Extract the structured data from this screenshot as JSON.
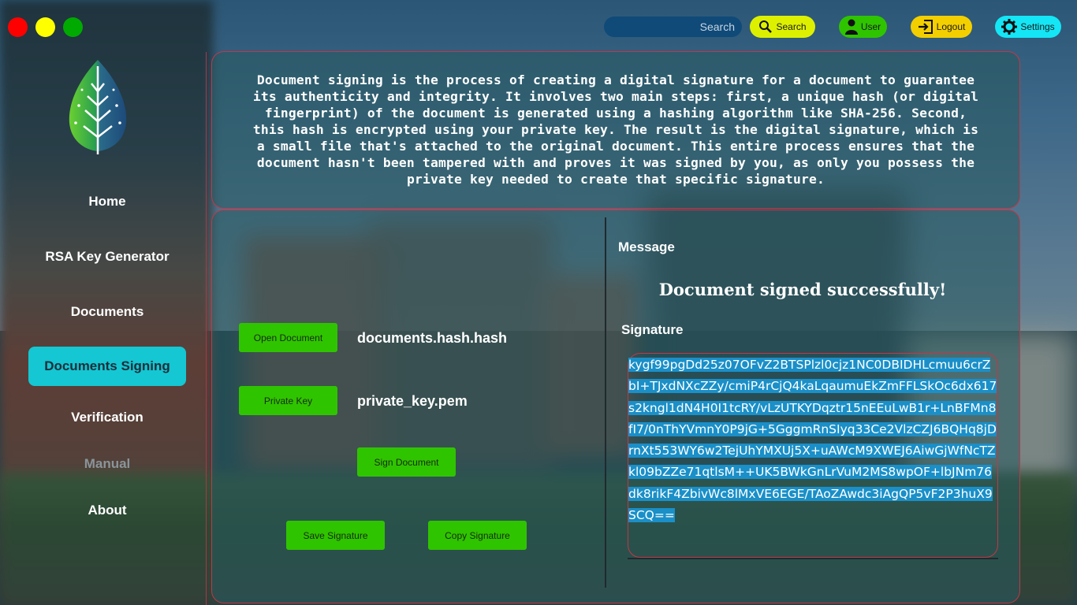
{
  "window": {
    "controls": [
      {
        "name": "close",
        "color": "#ff0000"
      },
      {
        "name": "minimize",
        "color": "#ffff00"
      },
      {
        "name": "maximize",
        "color": "#00aa00"
      }
    ]
  },
  "topbar": {
    "search_placeholder": "Search",
    "search_button": {
      "label": "Search",
      "icon": "search-icon",
      "color": "#ddf000"
    },
    "user_button": {
      "label": "User",
      "icon": "user-icon",
      "color": "#2fc400"
    },
    "logout_button": {
      "label": "Logout",
      "icon": "logout-icon",
      "color": "#f3cf00"
    },
    "settings_button": {
      "label": "Settings",
      "icon": "gear-icon",
      "color": "#14e6f5"
    }
  },
  "sidebar": {
    "logo_icon": "leaf-circuit-logo",
    "items": [
      {
        "label": "Home",
        "active": false,
        "disabled": false
      },
      {
        "label": "RSA Key Generator",
        "active": false,
        "disabled": false
      },
      {
        "label": "Documents",
        "active": false,
        "disabled": false
      },
      {
        "label": "Documents Signing",
        "active": true,
        "disabled": false
      },
      {
        "label": "Verification",
        "active": false,
        "disabled": false
      },
      {
        "label": "Manual",
        "active": false,
        "disabled": true
      },
      {
        "label": "About",
        "active": false,
        "disabled": false
      }
    ]
  },
  "description": {
    "lines": [
      "Document signing is the process of creating a digital signature for a document to guarantee",
      "its authenticity and integrity. It involves two main steps: first, a unique hash (or digital",
      "fingerprint) of the document is generated using a hashing algorithm like SHA-256. Second,",
      "this hash is encrypted using your private key. The result is the digital signature, which is",
      "a small file that's attached to the original document. This entire process ensures that the",
      "document hasn't been tampered with and proves it was signed by you, as only you possess the",
      "private key needed to create that specific signature."
    ]
  },
  "signing": {
    "open_document_button": "Open Document",
    "document_file": "documents.hash.hash",
    "private_key_button": "Private Key",
    "private_key_file": "private_key.pem",
    "sign_button": "Sign Document",
    "save_button": "Save Signature",
    "copy_button": "Copy Signature"
  },
  "result": {
    "message_heading": "Message",
    "message": "Document signed successfully!",
    "signature_heading": "Signature",
    "signature": "kygf99pgDd25z07OFvZ2BTSPlzl0cjz1NC0DBIDHLcmuu6crZbI+TJxdNXcZZy/cmiP4rCjQ4kaLqaumuEkZmFFLSkOc6dx617s2kngl1dN4H0I1tcRY/vLzUTKYDqztr15nEEuLwB1r+LnBFMn8fI7/0nThYVmnY0P9jG+5GggmRnSIyq33Ce2VlzCZJ6BQHq8jDrnXt553WY6w2TejUhYMXUj5X+uAWcM9XWEJ6AiwGjWfNcTZkl09bZZe71qtlsM++UK5BWkGnLrVuM2MS8wpOF+lbJNm76dk8rikF4ZbivWc8lMxVE6EGE/TAoZAwdc3iAgQP5vF2P3huX9SCQ=="
  },
  "colors": {
    "accent": "#14c7d2",
    "panel_border": "#c33747",
    "button_green": "#2fc400",
    "signature_highlight": "#1a8fc8"
  }
}
